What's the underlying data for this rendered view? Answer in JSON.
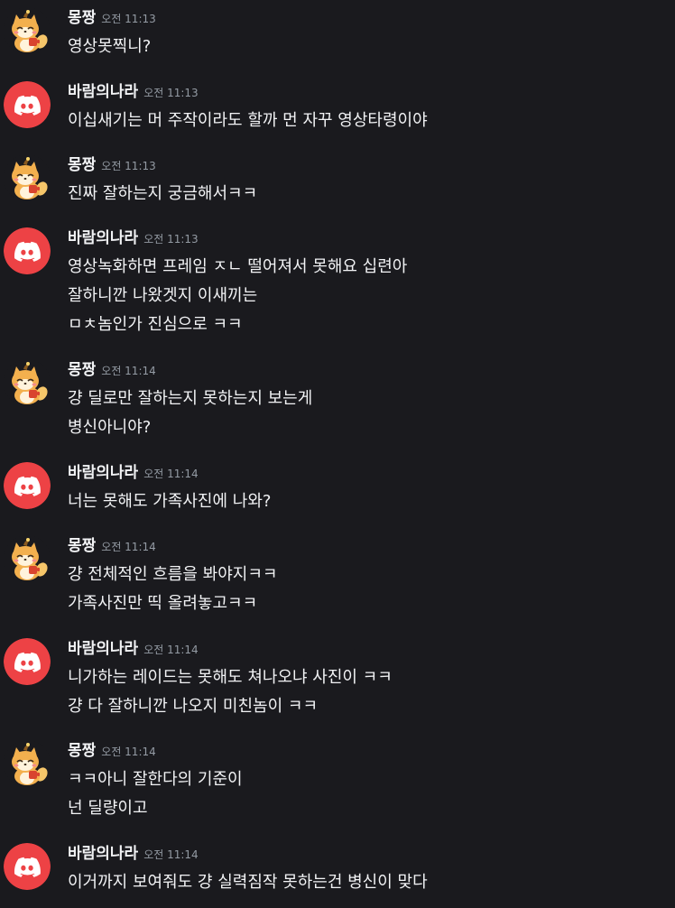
{
  "colors": {
    "background": "#1a1a1e",
    "text": "#f2f3f5",
    "timestamp": "#949ba4",
    "discord_red": "#ed4245"
  },
  "messages": [
    {
      "user": "몽짱",
      "avatar": "shiba-sticker-icon",
      "time": "오전 11:13",
      "lines": [
        "영상못찍니?"
      ]
    },
    {
      "user": "바람의나라",
      "avatar": "discord-logo-icon",
      "time": "오전 11:13",
      "lines": [
        "이십새기는 머 주작이라도 할까 먼 자꾸 영상타령이야"
      ]
    },
    {
      "user": "몽짱",
      "avatar": "shiba-sticker-icon",
      "time": "오전 11:13",
      "lines": [
        "진짜 잘하는지 궁금해서ㅋㅋ"
      ]
    },
    {
      "user": "바람의나라",
      "avatar": "discord-logo-icon",
      "time": "오전 11:13",
      "lines": [
        "영상녹화하면 프레임 ㅈㄴ 떨어져서 못해요 십련아",
        "잘하니깐 나왔겟지 이새끼는",
        "ㅁㅊ놈인가 진심으로 ㅋㅋ"
      ]
    },
    {
      "user": "몽짱",
      "avatar": "shiba-sticker-icon",
      "time": "오전 11:14",
      "lines": [
        "걍 딜로만 잘하는지 못하는지 보는게",
        "병신아니야?"
      ]
    },
    {
      "user": "바람의나라",
      "avatar": "discord-logo-icon",
      "time": "오전 11:14",
      "lines": [
        "너는 못해도 가족사진에 나와?"
      ]
    },
    {
      "user": "몽짱",
      "avatar": "shiba-sticker-icon",
      "time": "오전 11:14",
      "lines": [
        "걍 전체적인 흐름을 봐야지ㅋㅋ",
        "가족사진만 띡 올려놓고ㅋㅋ"
      ]
    },
    {
      "user": "바람의나라",
      "avatar": "discord-logo-icon",
      "time": "오전 11:14",
      "lines": [
        "니가하는 레이드는 못해도 쳐나오냐 사진이 ㅋㅋ",
        "걍 다 잘하니깐 나오지 미친놈이 ㅋㅋ"
      ]
    },
    {
      "user": "몽짱",
      "avatar": "shiba-sticker-icon",
      "time": "오전 11:14",
      "lines": [
        "ㅋㅋ아니 잘한다의 기준이",
        "넌 딜량이고"
      ]
    },
    {
      "user": "바람의나라",
      "avatar": "discord-logo-icon",
      "time": "오전 11:14",
      "lines": [
        "이거까지 보여줘도 걍 실력짐작 못하는건 병신이 맞다"
      ]
    }
  ]
}
